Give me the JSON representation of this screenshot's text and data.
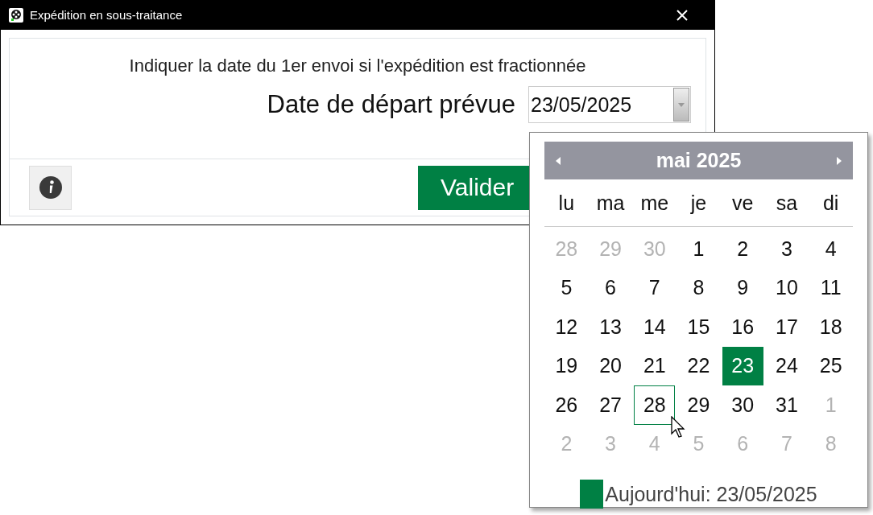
{
  "window": {
    "title": "Expédition en sous-traitance"
  },
  "instruction": "Indiquer la date du 1er envoi si l'expédition est fractionnée",
  "date_field": {
    "label": "Date de départ prévue",
    "value": "23/05/2025"
  },
  "buttons": {
    "validate": "Valider"
  },
  "calendar": {
    "month": "mai 2025",
    "weekdays": [
      "lu",
      "ma",
      "me",
      "je",
      "ve",
      "sa",
      "di"
    ],
    "days": [
      {
        "label": "28",
        "in_month": false,
        "selected": false,
        "hovered": false
      },
      {
        "label": "29",
        "in_month": false,
        "selected": false,
        "hovered": false
      },
      {
        "label": "30",
        "in_month": false,
        "selected": false,
        "hovered": false
      },
      {
        "label": "1",
        "in_month": true,
        "selected": false,
        "hovered": false
      },
      {
        "label": "2",
        "in_month": true,
        "selected": false,
        "hovered": false
      },
      {
        "label": "3",
        "in_month": true,
        "selected": false,
        "hovered": false
      },
      {
        "label": "4",
        "in_month": true,
        "selected": false,
        "hovered": false
      },
      {
        "label": "5",
        "in_month": true,
        "selected": false,
        "hovered": false
      },
      {
        "label": "6",
        "in_month": true,
        "selected": false,
        "hovered": false
      },
      {
        "label": "7",
        "in_month": true,
        "selected": false,
        "hovered": false
      },
      {
        "label": "8",
        "in_month": true,
        "selected": false,
        "hovered": false
      },
      {
        "label": "9",
        "in_month": true,
        "selected": false,
        "hovered": false
      },
      {
        "label": "10",
        "in_month": true,
        "selected": false,
        "hovered": false
      },
      {
        "label": "11",
        "in_month": true,
        "selected": false,
        "hovered": false
      },
      {
        "label": "12",
        "in_month": true,
        "selected": false,
        "hovered": false
      },
      {
        "label": "13",
        "in_month": true,
        "selected": false,
        "hovered": false
      },
      {
        "label": "14",
        "in_month": true,
        "selected": false,
        "hovered": false
      },
      {
        "label": "15",
        "in_month": true,
        "selected": false,
        "hovered": false
      },
      {
        "label": "16",
        "in_month": true,
        "selected": false,
        "hovered": false
      },
      {
        "label": "17",
        "in_month": true,
        "selected": false,
        "hovered": false
      },
      {
        "label": "18",
        "in_month": true,
        "selected": false,
        "hovered": false
      },
      {
        "label": "19",
        "in_month": true,
        "selected": false,
        "hovered": false
      },
      {
        "label": "20",
        "in_month": true,
        "selected": false,
        "hovered": false
      },
      {
        "label": "21",
        "in_month": true,
        "selected": false,
        "hovered": false
      },
      {
        "label": "22",
        "in_month": true,
        "selected": false,
        "hovered": false
      },
      {
        "label": "23",
        "in_month": true,
        "selected": true,
        "hovered": false
      },
      {
        "label": "24",
        "in_month": true,
        "selected": false,
        "hovered": false
      },
      {
        "label": "25",
        "in_month": true,
        "selected": false,
        "hovered": false
      },
      {
        "label": "26",
        "in_month": true,
        "selected": false,
        "hovered": false
      },
      {
        "label": "27",
        "in_month": true,
        "selected": false,
        "hovered": false
      },
      {
        "label": "28",
        "in_month": true,
        "selected": false,
        "hovered": true
      },
      {
        "label": "29",
        "in_month": true,
        "selected": false,
        "hovered": false
      },
      {
        "label": "30",
        "in_month": true,
        "selected": false,
        "hovered": false
      },
      {
        "label": "31",
        "in_month": true,
        "selected": false,
        "hovered": false
      },
      {
        "label": "1",
        "in_month": false,
        "selected": false,
        "hovered": false
      },
      {
        "label": "2",
        "in_month": false,
        "selected": false,
        "hovered": false
      },
      {
        "label": "3",
        "in_month": false,
        "selected": false,
        "hovered": false
      },
      {
        "label": "4",
        "in_month": false,
        "selected": false,
        "hovered": false
      },
      {
        "label": "5",
        "in_month": false,
        "selected": false,
        "hovered": false
      },
      {
        "label": "6",
        "in_month": false,
        "selected": false,
        "hovered": false
      },
      {
        "label": "7",
        "in_month": false,
        "selected": false,
        "hovered": false
      },
      {
        "label": "8",
        "in_month": false,
        "selected": false,
        "hovered": false
      }
    ],
    "today": "Aujourd'hui: 23/05/2025"
  }
}
